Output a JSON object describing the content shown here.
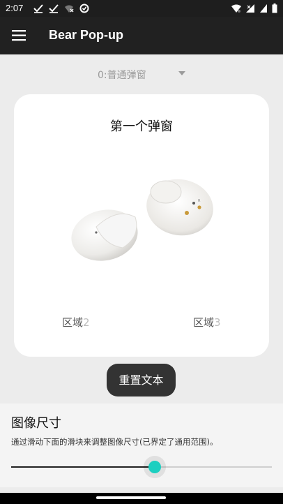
{
  "status_bar": {
    "time": "2:07",
    "left_icons": [
      "check-icon",
      "check-icon",
      "wifi-off-icon",
      "data-saver-icon"
    ],
    "right_icons": [
      "wifi-icon",
      "signal-x-icon",
      "signal-icon",
      "battery-icon"
    ]
  },
  "app_bar": {
    "title": "Bear Pop-up",
    "menu_icon": "menu-icon",
    "background": "#212121"
  },
  "popup_selector": {
    "selected": "0:普通弹窗"
  },
  "preview_card": {
    "title": "第一个弹窗",
    "region2_label": "区域",
    "region2_number": "2",
    "region3_label": "区域",
    "region3_number": "3"
  },
  "toast": {
    "text": "重置文本"
  },
  "image_size": {
    "title": "图像尺寸",
    "description": "通过滑动下面的滑块来调整图像尺寸(已界定了通用范围)。",
    "slider_value": 0.55,
    "accent": "#1ccfc0"
  }
}
